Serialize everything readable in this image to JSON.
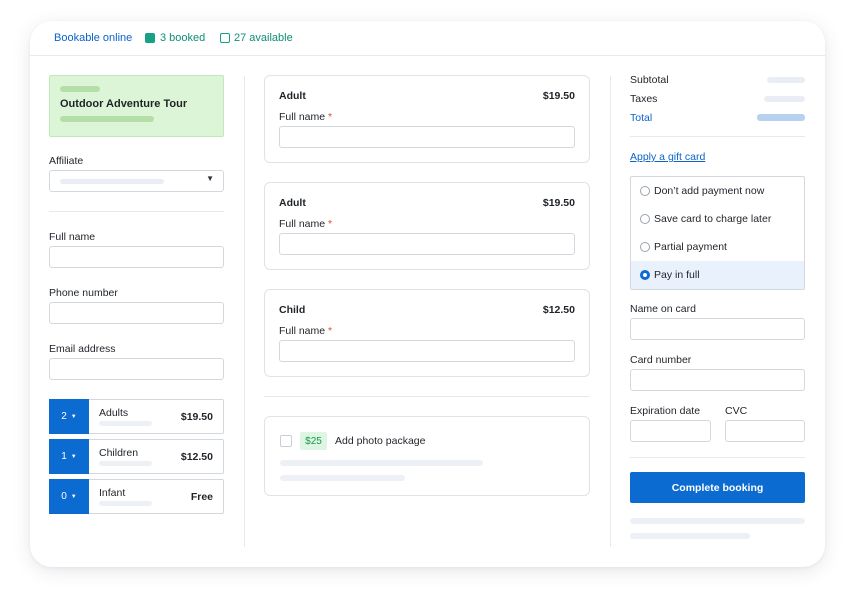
{
  "topbar": {
    "bookable_link": "Bookable online",
    "booked_label": "3 booked",
    "available_label": "27 available"
  },
  "tour": {
    "title": "Outdoor Adventure Tour"
  },
  "contact": {
    "affiliate_label": "Affiliate",
    "full_name_label": "Full name",
    "phone_label": "Phone number",
    "email_label": "Email address"
  },
  "quantities": [
    {
      "count": "2",
      "name": "Adults",
      "price": "$19.50"
    },
    {
      "count": "1",
      "name": "Children",
      "price": "$12.50"
    },
    {
      "count": "0",
      "name": "Infant",
      "price": "Free"
    }
  ],
  "participants": [
    {
      "type": "Adult",
      "price": "$19.50",
      "field_label": "Full name",
      "required_mark": "*"
    },
    {
      "type": "Adult",
      "price": "$19.50",
      "field_label": "Full name",
      "required_mark": "*"
    },
    {
      "type": "Child",
      "price": "$12.50",
      "field_label": "Full name",
      "required_mark": "*"
    }
  ],
  "addon": {
    "price_badge": "$25",
    "label": "Add photo package"
  },
  "summary": {
    "subtotal_label": "Subtotal",
    "taxes_label": "Taxes",
    "total_label": "Total"
  },
  "gift_card_link": "Apply a gift card",
  "payment_options": [
    {
      "label": "Don’t add payment now",
      "selected": false
    },
    {
      "label": "Save card to charge later",
      "selected": false
    },
    {
      "label": "Partial payment",
      "selected": false
    },
    {
      "label": "Pay in full",
      "selected": true
    }
  ],
  "card": {
    "name_label": "Name on card",
    "number_label": "Card number",
    "expiration_label": "Expiration date",
    "cvc_label": "CVC"
  },
  "complete_button": "Complete booking",
  "colors": {
    "primary": "#0b6bd0",
    "link": "#0b63c9",
    "booked": "#16a085",
    "tour_bg": "#dcf5d6",
    "required": "#e2483d"
  }
}
